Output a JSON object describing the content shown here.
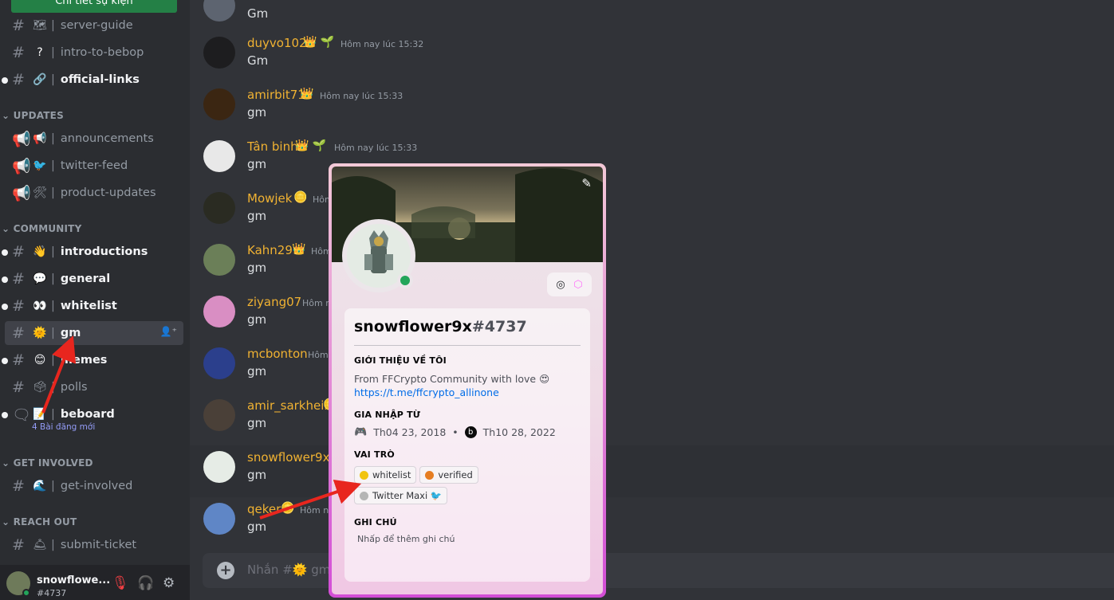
{
  "sidebar": {
    "event_button": "Chi tiết sự kiện",
    "categories": {
      "updates": "UPDATES",
      "community": "COMMUNITY",
      "get_involved": "GET INVOLVED",
      "reach_out": "REACH OUT"
    },
    "channels": {
      "server_guide": "server-guide",
      "intro_to_bebop": "intro-to-bebop",
      "official_links": "official-links",
      "announcements": "announcements",
      "twitter_feed": "twitter-feed",
      "product_updates": "product-updates",
      "introductions": "introductions",
      "general": "general",
      "whitelist": "whitelist",
      "gm": "gm",
      "memes": "memes",
      "polls": "polls",
      "beboard": "beboard",
      "get_involved": "get-involved",
      "submit_ticket": "submit-ticket"
    },
    "beboard_note": "4 Bài đăng mới"
  },
  "user": {
    "name": "snowflowe...",
    "tag": "#4737"
  },
  "messages": [
    {
      "user": "",
      "time": "",
      "text": "Gm"
    },
    {
      "user": "duyvo102",
      "time": "Hôm nay lúc 15:32",
      "text": "Gm"
    },
    {
      "user": "amirbit71",
      "time": "Hôm nay lúc 15:33",
      "text": "gm"
    },
    {
      "user": "Tân binh",
      "time": "Hôm nay lúc 15:33",
      "text": "gm"
    },
    {
      "user": "Mowjek",
      "time": "Hôm",
      "text": "gm"
    },
    {
      "user": "Kahn29",
      "time": "Hôm",
      "text": "gm"
    },
    {
      "user": "ziyang07",
      "time": "Hôm nay",
      "text": "gm"
    },
    {
      "user": "mcbonton",
      "time": "Hôm",
      "text": "gm"
    },
    {
      "user": "amir_sarkheil",
      "time": "",
      "text": "gm"
    },
    {
      "user": "snowflower9x",
      "time": "",
      "text": "gm"
    },
    {
      "user": "qeker",
      "time": "Hôm na",
      "text": "gm"
    }
  ],
  "composer": {
    "placeholder": "Nhắn #",
    "after": "gm"
  },
  "profile": {
    "username": "snowflower9x",
    "discriminator": "#4737",
    "about_title": "GIỚI THIỆU VỀ TÔI",
    "about_text": "From FFCrypto Community with love",
    "about_link": "https://t.me/ffcrypto_allinone",
    "joined_title": "GIA NHẬP TỪ",
    "joined_discord": "Th04 23, 2018",
    "joined_server": "Th10 28, 2022",
    "roles_title": "VAI TRÒ",
    "roles": [
      {
        "name": "whitelist",
        "color": "#f1c40f"
      },
      {
        "name": "verified",
        "color": "#e67e22"
      },
      {
        "name": "Twitter Maxi",
        "color": "#b5b5b5"
      }
    ],
    "note_title": "GHI CHÚ",
    "note_placeholder": "Nhấp để thêm ghi chú"
  }
}
